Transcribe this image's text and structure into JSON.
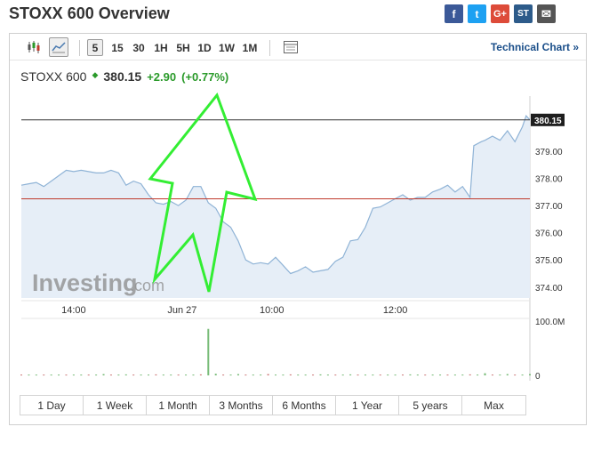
{
  "page": {
    "title": "STOXX 600 Overview"
  },
  "share": [
    {
      "name": "facebook-share-icon",
      "glyph": "f",
      "color": "#3b5998"
    },
    {
      "name": "twitter-share-icon",
      "glyph": "t",
      "color": "#1da1f2"
    },
    {
      "name": "google-plus-share-icon",
      "glyph": "G+",
      "color": "#dd4b39"
    },
    {
      "name": "stocktwits-share-icon",
      "glyph": "ST",
      "color": "#2d5b8a"
    },
    {
      "name": "email-share-icon",
      "glyph": "✉",
      "color": "#555555"
    }
  ],
  "toolbar": {
    "intervals": [
      "5",
      "15",
      "30",
      "1H",
      "5H",
      "1D",
      "1W",
      "1M"
    ],
    "selected_interval": "5",
    "technical_chart_label": "Technical Chart »"
  },
  "quote": {
    "name": "STOXX 600",
    "price": "380.15",
    "change": "+2.90",
    "change_pct": "(+0.77%)"
  },
  "chart": {
    "watermark_brand": "Investing",
    "watermark_domain": ".com",
    "last_price_label": "380.15",
    "volume_max_label": "100.0M",
    "volume_min_label": "0"
  },
  "ranges": [
    "1 Day",
    "1 Week",
    "1 Month",
    "3 Months",
    "6 Months",
    "1 Year",
    "5 years",
    "Max"
  ],
  "chart_data": {
    "type": "area",
    "title": "",
    "x_ticks": [
      "14:00",
      "Jun 27",
      "10:00",
      "12:00"
    ],
    "y_ticks": [
      379.0,
      378.0,
      377.0,
      376.0,
      375.0,
      374.0
    ],
    "ylim": [
      373.6,
      380.7
    ],
    "last_price": 380.15,
    "previous_close": 377.25,
    "colors": {
      "line": "#8fb3d6",
      "fill": "#e6eef7",
      "close_line": "#c0392b",
      "last_line": "#333333"
    },
    "price_series": [
      [
        0,
        377.75
      ],
      [
        2,
        377.8
      ],
      [
        4,
        377.85
      ],
      [
        6,
        377.7
      ],
      [
        8,
        377.9
      ],
      [
        10,
        378.1
      ],
      [
        12,
        378.3
      ],
      [
        14,
        378.25
      ],
      [
        16,
        378.3
      ],
      [
        18,
        378.25
      ],
      [
        20,
        378.2
      ],
      [
        22,
        378.2
      ],
      [
        24,
        378.3
      ],
      [
        26,
        378.2
      ],
      [
        28,
        377.75
      ],
      [
        30,
        377.9
      ],
      [
        32,
        377.8
      ],
      [
        34,
        377.4
      ],
      [
        36,
        377.1
      ],
      [
        38,
        377.05
      ],
      [
        40,
        377.15
      ],
      [
        42,
        377.0
      ],
      [
        44,
        377.2
      ],
      [
        46,
        377.7
      ],
      [
        48,
        377.7
      ],
      [
        50,
        377.1
      ],
      [
        52,
        376.9
      ],
      [
        54,
        376.4
      ],
      [
        56,
        376.2
      ],
      [
        58,
        375.7
      ],
      [
        60,
        375.0
      ],
      [
        62,
        374.85
      ],
      [
        64,
        374.9
      ],
      [
        66,
        374.85
      ],
      [
        68,
        375.1
      ],
      [
        70,
        374.8
      ],
      [
        72,
        374.5
      ],
      [
        74,
        374.6
      ],
      [
        76,
        374.75
      ],
      [
        78,
        374.55
      ],
      [
        80,
        374.6
      ],
      [
        82,
        374.65
      ],
      [
        84,
        374.95
      ],
      [
        86,
        375.1
      ],
      [
        88,
        375.7
      ],
      [
        90,
        375.75
      ],
      [
        92,
        376.2
      ],
      [
        94,
        376.9
      ],
      [
        96,
        376.95
      ],
      [
        98,
        377.1
      ],
      [
        100,
        377.25
      ],
      [
        102,
        377.4
      ],
      [
        104,
        377.2
      ],
      [
        106,
        377.3
      ],
      [
        108,
        377.3
      ],
      [
        110,
        377.5
      ],
      [
        112,
        377.6
      ],
      [
        114,
        377.75
      ],
      [
        116,
        377.5
      ],
      [
        118,
        377.7
      ],
      [
        120,
        377.3
      ],
      [
        121,
        379.2
      ],
      [
        123,
        379.35
      ],
      [
        124,
        379.4
      ],
      [
        126,
        379.55
      ],
      [
        128,
        379.4
      ],
      [
        130,
        379.75
      ],
      [
        132,
        379.35
      ],
      [
        134,
        379.9
      ],
      [
        135,
        380.3
      ],
      [
        136,
        380.15
      ]
    ],
    "volume_series": [
      [
        0,
        0.5
      ],
      [
        8,
        0.5
      ],
      [
        16,
        0.5
      ],
      [
        22,
        0.8
      ],
      [
        28,
        0.6
      ],
      [
        36,
        0.6
      ],
      [
        44,
        0.5
      ],
      [
        48,
        0.6
      ],
      [
        50,
        28.0
      ],
      [
        52,
        1.0
      ],
      [
        58,
        0.8
      ],
      [
        66,
        0.8
      ],
      [
        72,
        0.6
      ],
      [
        80,
        0.6
      ],
      [
        88,
        0.6
      ],
      [
        96,
        0.5
      ],
      [
        104,
        0.6
      ],
      [
        112,
        0.5
      ],
      [
        120,
        0.6
      ],
      [
        124,
        1.3
      ],
      [
        130,
        0.8
      ],
      [
        136,
        0.8
      ]
    ],
    "volume_ylim": [
      0,
      30
    ],
    "x_tick_positions": [
      14,
      43,
      67,
      100
    ]
  }
}
